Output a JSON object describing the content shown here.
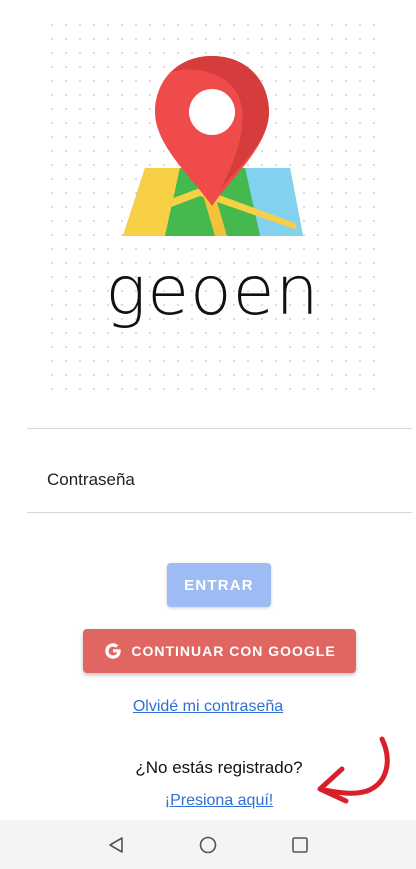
{
  "logo": {
    "wordmark": "geoen"
  },
  "form": {
    "password_label": "Contraseña",
    "enter_label": "ENTRAR",
    "google_label": "CONTINUAR CON GOOGLE",
    "forgot_link": "Olvidé mi contraseña"
  },
  "register": {
    "question": "¿No estás registrado?",
    "link": "¡Presiona aquí!"
  },
  "colors": {
    "enter_button": "#9ebbf4",
    "google_button": "#e06661",
    "link": "#2f6fd6",
    "annotation_arrow": "#d81f2a"
  },
  "nav": {
    "icons": [
      "back-icon",
      "home-icon",
      "recents-icon"
    ]
  }
}
